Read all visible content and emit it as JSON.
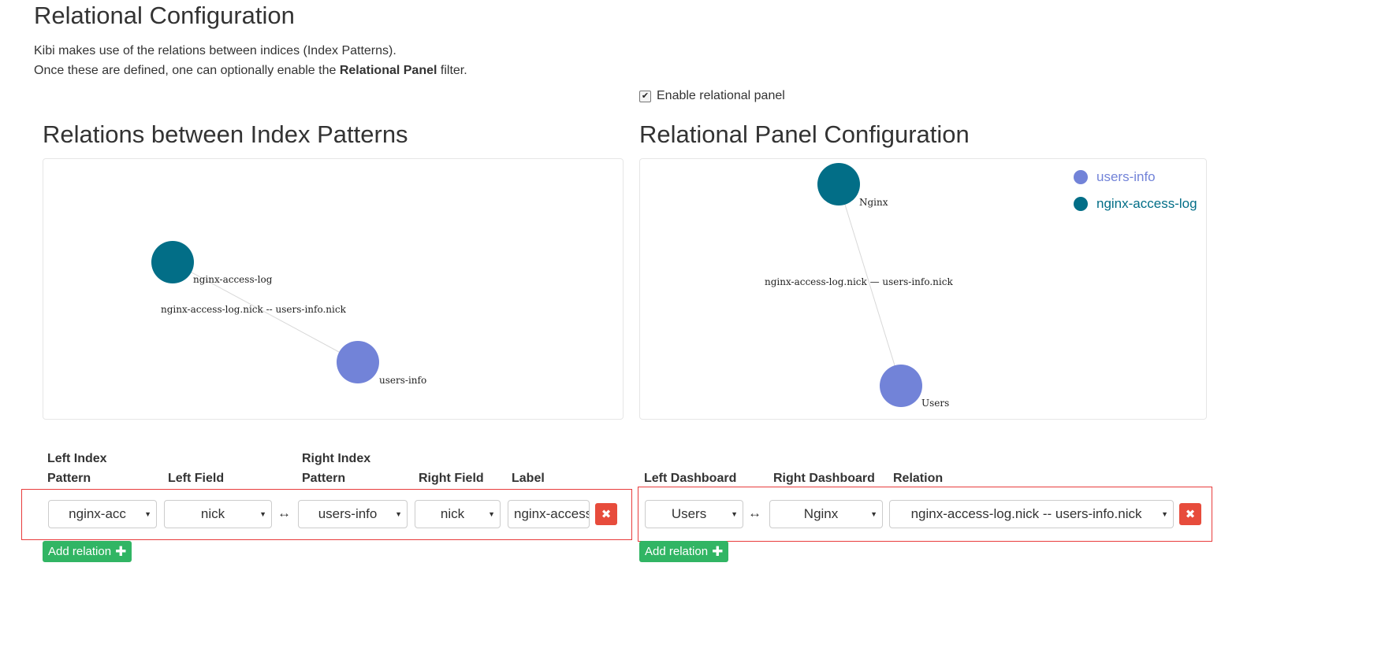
{
  "header": {
    "title": "Relational Configuration",
    "intro_line1": "Kibi makes use of the relations between indices (Index Patterns).",
    "intro_line2_pre": "Once these are defined, one can optionally enable the ",
    "intro_line2_bold": "Relational Panel",
    "intro_line2_post": " filter."
  },
  "enable_panel": {
    "label": "Enable relational panel",
    "checked": true
  },
  "left_section": {
    "title": "Relations between Index Patterns",
    "graph": {
      "nodes": [
        {
          "label": "nginx-access-log",
          "color": "#026e87"
        },
        {
          "label": "users-info",
          "color": "#7283d8"
        }
      ],
      "edge_label": "nginx-access-log.nick -- users-info.nick"
    },
    "columns": {
      "left_index_pattern_1": "Left Index",
      "left_index_pattern_2": "Pattern",
      "left_field": "Left Field",
      "right_index_pattern_1": "Right Index",
      "right_index_pattern_2": "Pattern",
      "right_field": "Right Field",
      "label": "Label"
    },
    "row": {
      "left_index": "nginx-acc",
      "left_field": "nick",
      "right_index": "users-info",
      "right_field": "nick",
      "label": "nginx-access"
    },
    "add_button": "Add relation"
  },
  "right_section": {
    "title": "Relational Panel Configuration",
    "graph": {
      "nodes": [
        {
          "label": "Nginx",
          "color": "#026e87"
        },
        {
          "label": "Users",
          "color": "#7283d8"
        }
      ],
      "edge_label": "nginx-access-log.nick — users-info.nick"
    },
    "legend": [
      {
        "label": "users-info",
        "color": "#7283d8"
      },
      {
        "label": "nginx-access-log",
        "color": "#026e87"
      }
    ],
    "columns": {
      "left_dashboard": "Left Dashboard",
      "right_dashboard": "Right Dashboard",
      "relation": "Relation"
    },
    "row": {
      "left_dashboard": "Users",
      "right_dashboard": "Nginx",
      "relation": "nginx-access-log.nick -- users-info.nick"
    },
    "add_button": "Add relation"
  },
  "icons": {
    "double_arrow": "↔",
    "remove": "✖",
    "plus": "✚",
    "check": "✔",
    "caret": "▼"
  }
}
